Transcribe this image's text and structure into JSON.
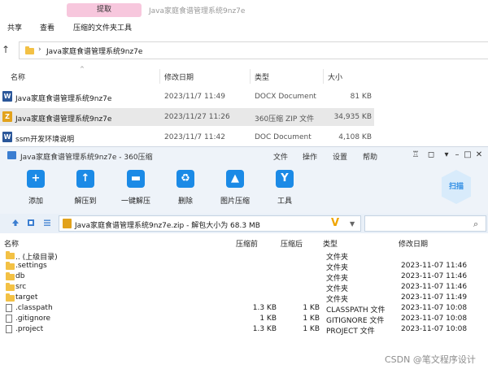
{
  "explorer": {
    "contextual_tab": "提取",
    "window_title": "Java家庭食谱管理系统9nz7e",
    "ribbon_tabs": [
      "共享",
      "查看",
      "压缩的文件夹工具"
    ],
    "address": "Java家庭食谱管理系统9nz7e",
    "columns": [
      "名称",
      "修改日期",
      "类型",
      "大小"
    ],
    "files": [
      {
        "name": "Java家庭食谱管理系统9nz7e",
        "date": "2023/11/7 11:49",
        "type": "DOCX Document",
        "size": "81 KB",
        "icon": "word-doc-icon",
        "color": "#2b579a"
      },
      {
        "name": "Java家庭食谱管理系统9nz7e",
        "date": "2023/11/27 11:26",
        "type": "360压缩 ZIP 文件",
        "size": "34,935 KB",
        "icon": "zip-archive-icon",
        "color": "#e2a21c"
      },
      {
        "name": "ssm开发环境说明",
        "date": "2023/11/7 11:42",
        "type": "DOC Document",
        "size": "4,108 KB",
        "icon": "word-doc-icon",
        "color": "#2b579a"
      }
    ]
  },
  "zip": {
    "title": "Java家庭食谱管理系统9nz7e - 360压缩",
    "menu": [
      "文件",
      "操作",
      "设置",
      "帮助"
    ],
    "tools": [
      {
        "label": "添加",
        "icon": "add-icon",
        "glyph": "+"
      },
      {
        "label": "解压到",
        "icon": "extract-to-icon",
        "glyph": "↑"
      },
      {
        "label": "一键解压",
        "icon": "one-click-extract-icon",
        "glyph": "▬"
      },
      {
        "label": "删除",
        "icon": "delete-icon",
        "glyph": "♻"
      },
      {
        "label": "图片压缩",
        "icon": "image-compress-icon",
        "glyph": "▲"
      },
      {
        "label": "工具",
        "icon": "tools-icon",
        "glyph": "Y"
      }
    ],
    "scan_label": "扫描",
    "path": "Java家庭食谱管理系统9nz7e.zip - 解包大小为 68.3 MB",
    "columns": [
      "名称",
      "压缩前",
      "压缩后",
      "类型",
      "修改日期"
    ],
    "rows": [
      {
        "name": ".. (上级目录)",
        "before": "",
        "after": "",
        "type": "文件夹",
        "date": "",
        "kind": "folder"
      },
      {
        "name": ".settings",
        "before": "",
        "after": "",
        "type": "文件夹",
        "date": "2023-11-07 11:46",
        "kind": "folder"
      },
      {
        "name": "db",
        "before": "",
        "after": "",
        "type": "文件夹",
        "date": "2023-11-07 11:46",
        "kind": "folder"
      },
      {
        "name": "src",
        "before": "",
        "after": "",
        "type": "文件夹",
        "date": "2023-11-07 11:46",
        "kind": "folder"
      },
      {
        "name": "target",
        "before": "",
        "after": "",
        "type": "文件夹",
        "date": "2023-11-07 11:49",
        "kind": "folder"
      },
      {
        "name": ".classpath",
        "before": "1.3 KB",
        "after": "1 KB",
        "type": "CLASSPATH 文件",
        "date": "2023-11-07 10:08",
        "kind": "file"
      },
      {
        "name": ".gitignore",
        "before": "1 KB",
        "after": "1 KB",
        "type": "GITIGNORE 文件",
        "date": "2023-11-07 10:08",
        "kind": "file"
      },
      {
        "name": ".project",
        "before": "1.3 KB",
        "after": "1 KB",
        "type": "PROJECT 文件",
        "date": "2023-11-07 10:08",
        "kind": "file"
      }
    ]
  },
  "watermark": "CSDN @笔文程序设计"
}
